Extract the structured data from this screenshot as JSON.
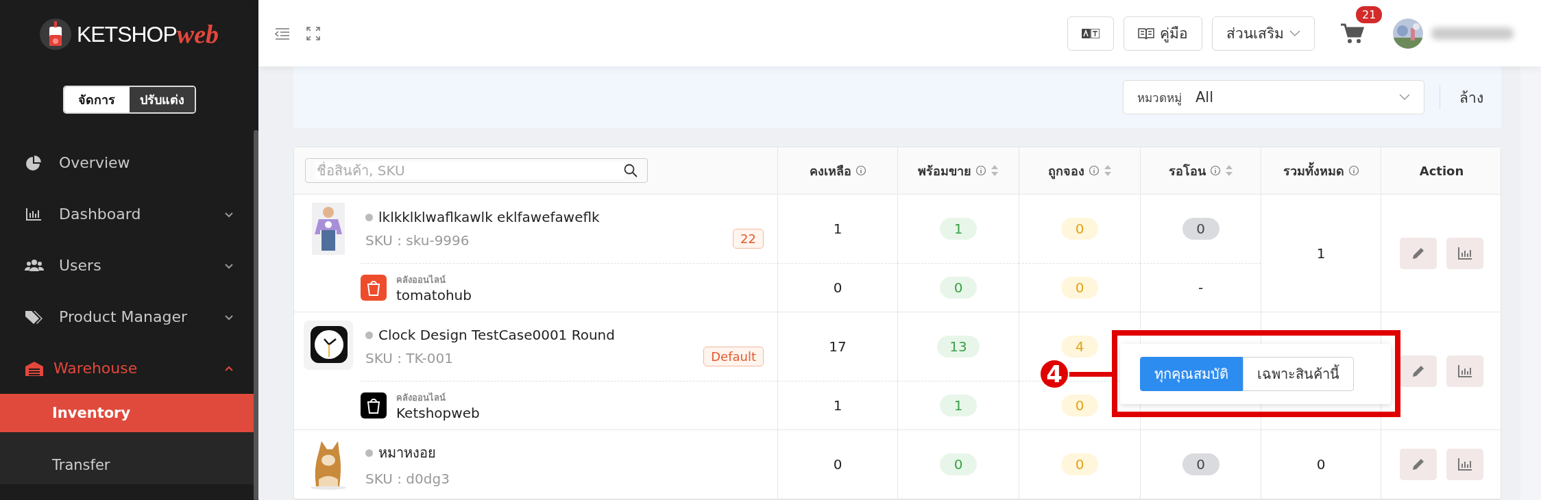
{
  "sidebar": {
    "logo": {
      "word": "KETSHOP",
      "accent": "web"
    },
    "mode_toggle": [
      {
        "label": "จัดการ",
        "selected": true
      },
      {
        "label": "ปรับแต่ง",
        "selected": false
      }
    ],
    "items": [
      {
        "label": "Overview",
        "selected": false
      },
      {
        "label": "Dashboard",
        "selected": false,
        "expanded": false
      },
      {
        "label": "Users",
        "selected": false,
        "expanded": false
      },
      {
        "label": "Product Manager",
        "selected": false,
        "expanded": false
      },
      {
        "label": "Warehouse",
        "selected": true,
        "expanded": true,
        "children": [
          {
            "label": "Inventory",
            "selected": true
          },
          {
            "label": "Transfer",
            "selected": false
          }
        ]
      }
    ]
  },
  "header": {
    "buttons": [
      {
        "kind": "translate"
      },
      {
        "kind": "book",
        "label": "คู่มือ"
      },
      {
        "kind": "dropdown",
        "label": "ส่วนเสริม"
      }
    ],
    "cart_count": "21"
  },
  "filter": {
    "label": "หมวดหมู่",
    "value": "All",
    "clear": "ล้าง"
  },
  "table": {
    "search": {
      "placeholder": "ชื่อสินค้า, SKU"
    },
    "columns": [
      {
        "label": "คงเหลือ",
        "info": true,
        "sortable": false
      },
      {
        "label": "พร้อมขาย",
        "info": true,
        "sortable": true
      },
      {
        "label": "ถูกจอง",
        "info": true,
        "sortable": true
      },
      {
        "label": "รอโอน",
        "info": true,
        "sortable": true
      },
      {
        "label": "รวมทั้งหมด",
        "info": true,
        "sortable": false
      },
      {
        "label": "Action",
        "info": false,
        "sortable": false
      }
    ],
    "rows": [
      {
        "name": "lklkklklwaflkawlk eklfawefaweflk",
        "sku": "SKU : sku-9996",
        "badge": "22",
        "main": {
          "remaining": "1",
          "available": "1",
          "reserved": "0",
          "pending": {
            "text": "0",
            "kind": "pill"
          }
        },
        "channel": {
          "color": "#ee4d2d",
          "label": "คลังออนไลน์",
          "name": "tomatohub",
          "remaining": "0",
          "available": "0",
          "reserved": "0",
          "pending": {
            "text": "-",
            "kind": "plain"
          }
        },
        "total": "1"
      },
      {
        "name": "Clock Design TestCase0001 Round",
        "sku": "SKU : TK-001",
        "badge": "Default",
        "main": {
          "remaining": "17",
          "available": "13",
          "reserved": "4"
        },
        "channel": {
          "color": "#000000",
          "label": "คลังออนไลน์",
          "name": "Ketshopweb",
          "remaining": "1",
          "available": "1",
          "reserved": "0"
        }
      },
      {
        "name": "หมาหงอย",
        "sku": "SKU : d0dg3",
        "main": {
          "remaining": "0",
          "available": "0",
          "reserved": "0",
          "pending": {
            "text": "0",
            "kind": "pill"
          }
        },
        "total": "0"
      }
    ]
  },
  "popover": {
    "callout": "4",
    "options": [
      {
        "label": "ทุกคุณสมบัติ",
        "selected": true
      },
      {
        "label": "เฉพาะสินค้านี้",
        "selected": false
      }
    ]
  }
}
